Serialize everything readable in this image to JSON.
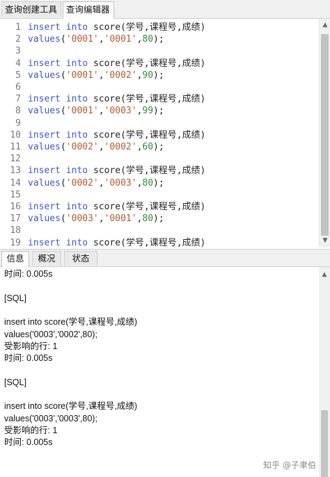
{
  "tabs": [
    "查询创建工具",
    "查询编辑器"
  ],
  "editor": {
    "lines": [
      {
        "n": "1",
        "kind": "insert"
      },
      {
        "n": "2",
        "kind": "values",
        "v": [
          "'0001'",
          "'0001'",
          "80"
        ]
      },
      {
        "n": "3",
        "kind": "blank"
      },
      {
        "n": "4",
        "kind": "insert"
      },
      {
        "n": "5",
        "kind": "values",
        "v": [
          "'0001'",
          "'0002'",
          "90"
        ]
      },
      {
        "n": "6",
        "kind": "blank"
      },
      {
        "n": "7",
        "kind": "insert"
      },
      {
        "n": "8",
        "kind": "values",
        "v": [
          "'0001'",
          "'0003'",
          "99"
        ]
      },
      {
        "n": "9",
        "kind": "blank"
      },
      {
        "n": "10",
        "kind": "insert"
      },
      {
        "n": "11",
        "kind": "values",
        "v": [
          "'0002'",
          "'0002'",
          "60"
        ]
      },
      {
        "n": "12",
        "kind": "blank"
      },
      {
        "n": "13",
        "kind": "insert"
      },
      {
        "n": "14",
        "kind": "values",
        "v": [
          "'0002'",
          "'0003'",
          "80"
        ]
      },
      {
        "n": "15",
        "kind": "blank"
      },
      {
        "n": "16",
        "kind": "insert"
      },
      {
        "n": "17",
        "kind": "values",
        "v": [
          "'0003'",
          "'0001'",
          "80"
        ]
      },
      {
        "n": "18",
        "kind": "blank"
      },
      {
        "n": "19",
        "kind": "insert"
      }
    ],
    "tokens": {
      "insert_kw": "insert",
      "into_kw": "into",
      "table": "score",
      "columns": "(学号,课程号,成绩)",
      "values_kw": "values"
    }
  },
  "bottom_tabs": [
    "信息",
    "概况",
    "状态"
  ],
  "messages": [
    "时间: 0.005s",
    "",
    "[SQL]",
    "",
    "insert into score(学号,课程号,成绩)",
    "values('0003','0002',80);",
    "受影响的行: 1",
    "时间: 0.005s",
    "",
    "[SQL]",
    "",
    "insert into score(学号,课程号,成绩)",
    "values('0003','0003',80);",
    "受影响的行: 1",
    "时间: 0.005s"
  ],
  "watermark": "知乎 @子聿伯",
  "icons": {
    "scroll_up": "▲",
    "scroll_down": "▼"
  }
}
